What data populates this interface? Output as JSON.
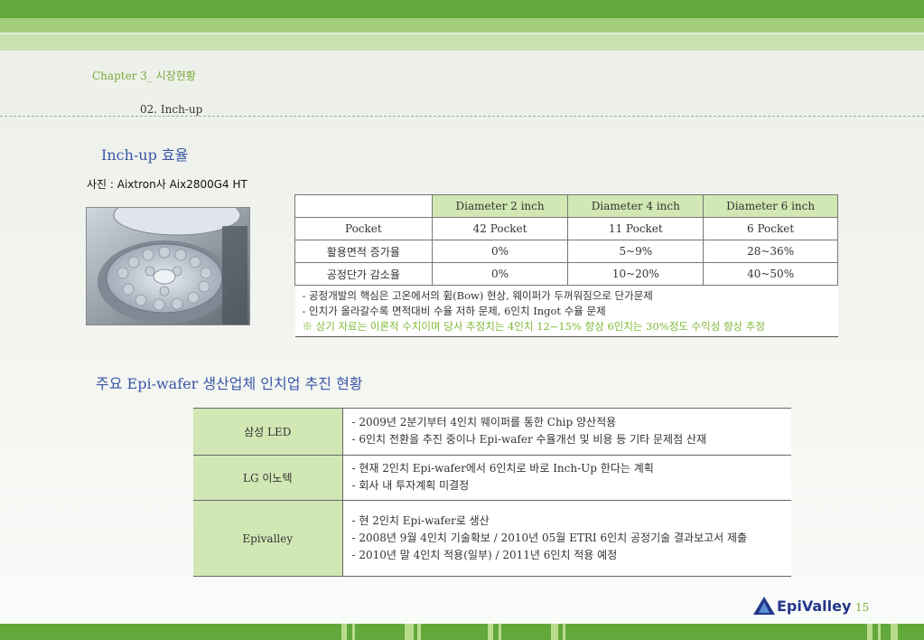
{
  "header": {
    "chapter": "Chapter 3_ 시장현황",
    "section": "02. Inch-up"
  },
  "inchup": {
    "heading": "Inch-up 효율",
    "caption": "사진 : Aixtron사 Aix2800G4 HT",
    "table": {
      "columns": [
        "Diameter 2 inch",
        "Diameter 4 inch",
        "Diameter 6 inch"
      ],
      "rows": [
        {
          "label": "Pocket",
          "values": [
            "42 Pocket",
            "11 Pocket",
            "6 Pocket"
          ]
        },
        {
          "label": "활용면적 증가율",
          "values": [
            "0%",
            "5~9%",
            "28~36%"
          ]
        },
        {
          "label": "공정단가 감소율",
          "values": [
            "0%",
            "10~20%",
            "40~50%"
          ]
        }
      ],
      "notes": [
        "- 공정개발의 핵심은 고온에서의 휨(Bow) 현상, 웨이퍼가 두꺼워짐으로 단가문제",
        "- 인치가 올라갈수록 면적대비 수율 저하 문제, 6인치 Ingot 수율 문제"
      ],
      "highlight_note": "※ 상기 자료는 이론적 수치이며 당사 추정치는 4인치 12~15% 향상 6인치는 30%정도 수익성 향상 추정"
    }
  },
  "epi": {
    "heading": "주요 Epi-wafer 생산업체 인치업 추진 현황",
    "rows": [
      {
        "company": "삼성 LED",
        "lines": [
          "- 2009년 2분기부터 4인치 웨이퍼를 통한 Chip 양산적용",
          "- 6인치 전환을 추진 중이나 Epi-wafer 수율개선 및 비용 등 기타 문제점 산재"
        ]
      },
      {
        "company": "LG 이노텍",
        "lines": [
          "- 현재 2인치 Epi-wafer에서 6인치로 바로 Inch-Up 한다는 계획",
          "- 회사 내 투자계획 미결정"
        ]
      },
      {
        "company": "Epivalley",
        "lines": [
          "- 현 2인치 Epi-wafer로 생산",
          "- 2008년 9월 4인치 기술확보 / 2010년 05월 ETRI 6인치 공정기술 결과보고서 제출",
          "- 2010년 말 4인치 적용(일부) / 2011년 6인치 적용 예정"
        ]
      }
    ]
  },
  "footer": {
    "logo_text": "EpiValley",
    "page_number": "15"
  },
  "colors": {
    "brand_green": "#63a83a",
    "table_header": "#d1e8b4",
    "heading_blue": "#3b56a8"
  }
}
